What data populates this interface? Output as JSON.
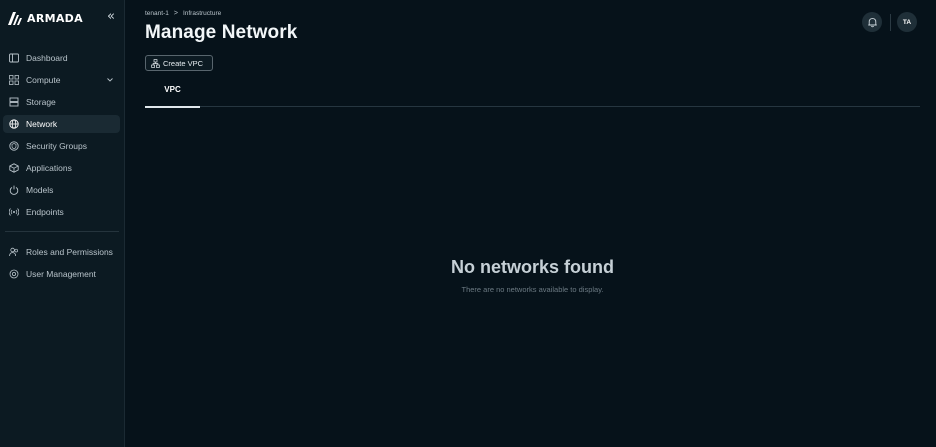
{
  "brand": {
    "name": "ARMADA",
    "collapse_icon": "«"
  },
  "sidebar": {
    "items": [
      {
        "label": "Dashboard",
        "icon": "panel-icon",
        "active": false
      },
      {
        "label": "Compute",
        "icon": "cluster-icon",
        "active": false,
        "has_submenu": true
      },
      {
        "label": "Storage",
        "icon": "storage-icon",
        "active": false
      },
      {
        "label": "Network",
        "icon": "globe-icon",
        "active": true
      },
      {
        "label": "Security Groups",
        "icon": "shield-icon",
        "active": false
      },
      {
        "label": "Applications",
        "icon": "box-icon",
        "active": false
      },
      {
        "label": "Models",
        "icon": "power-icon",
        "active": false
      },
      {
        "label": "Endpoints",
        "icon": "broadcast-icon",
        "active": false
      }
    ],
    "bottom_items": [
      {
        "label": "Roles and Permissions",
        "icon": "users-icon"
      },
      {
        "label": "User Management",
        "icon": "user-gear-icon"
      }
    ]
  },
  "breadcrumb": {
    "items": [
      "tenant-1",
      "Infrastructure"
    ],
    "separator": ">"
  },
  "page": {
    "title": "Manage Network"
  },
  "toolbar": {
    "create_label": "Create VPC"
  },
  "tabs": [
    {
      "label": "VPC",
      "active": true
    }
  ],
  "header": {
    "avatar_initials": "TA"
  },
  "empty_state": {
    "title": "No networks found",
    "description": "There are no networks available to display."
  },
  "colors": {
    "background": "#06121a",
    "sidebar": "#0c1a22",
    "active_item": "#1a2a33",
    "muted_text": "#6c7a83"
  }
}
